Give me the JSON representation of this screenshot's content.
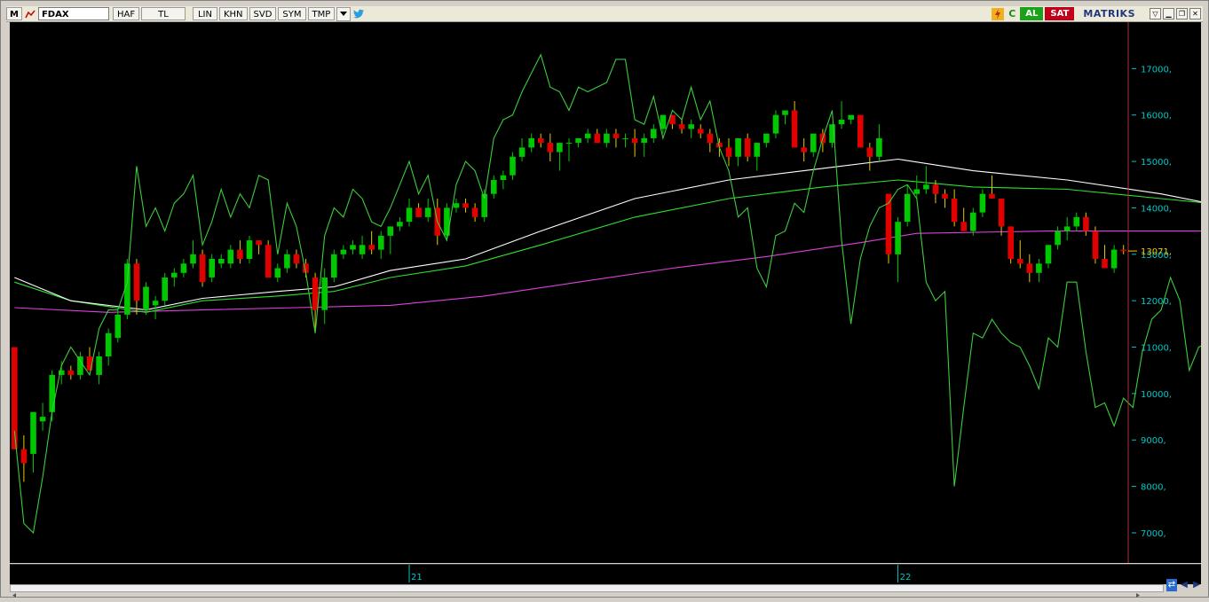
{
  "toolbar": {
    "m_label": "M",
    "symbol": "FDAX",
    "buttons": [
      "HAF",
      "TL",
      "LIN",
      "KHN",
      "SVD",
      "SYM",
      "TMP"
    ],
    "buy_label": "AL",
    "sell_label": "SAT",
    "brand": "MATRIKS"
  },
  "colors": {
    "background": "#000000",
    "up": "#00c800",
    "down": "#e00000",
    "ma_white": "#ffffff",
    "ma_green": "#2ee02e",
    "ma_magenta": "#e040e0",
    "indicator": "#3ccc3c",
    "axis_text": "#00c8c8",
    "last_price": "#e8c800"
  },
  "chart_data": {
    "type": "candlestick",
    "symbol": "FDAX",
    "last_price_label": "13071,",
    "y_ticks": [
      "7000,",
      "8000,",
      "9000,",
      "10000,",
      "11000,",
      "12000,",
      "13000,",
      "14000,",
      "15000,",
      "16000,",
      "17000,"
    ],
    "y_tick_values": [
      7000,
      8000,
      9000,
      10000,
      11000,
      12000,
      13000,
      14000,
      15000,
      16000,
      17000
    ],
    "ylim": [
      6350,
      18000
    ],
    "x_ticks": [
      "21",
      "22"
    ],
    "x_tick_index": [
      42,
      94
    ],
    "candles": [
      [
        11000,
        11000,
        8800,
        8800
      ],
      [
        8800,
        9100,
        8100,
        8500
      ],
      [
        8700,
        9600,
        8300,
        9600
      ],
      [
        9400,
        9800,
        9200,
        9500
      ],
      [
        9600,
        10500,
        9400,
        10400
      ],
      [
        10400,
        10700,
        10200,
        10500
      ],
      [
        10500,
        10600,
        10300,
        10400
      ],
      [
        10400,
        10900,
        10300,
        10800
      ],
      [
        10800,
        11000,
        10500,
        10500
      ],
      [
        10400,
        10900,
        10200,
        10800
      ],
      [
        10800,
        11400,
        10600,
        11300
      ],
      [
        11200,
        11800,
        11100,
        11700
      ],
      [
        11700,
        12900,
        11600,
        12800
      ],
      [
        12800,
        12900,
        11700,
        12000
      ],
      [
        11800,
        12400,
        11700,
        12300
      ],
      [
        11900,
        12100,
        11600,
        12000
      ],
      [
        12000,
        12600,
        11900,
        12500
      ],
      [
        12500,
        12700,
        12300,
        12600
      ],
      [
        12600,
        12900,
        12500,
        12800
      ],
      [
        12800,
        13300,
        12700,
        13000
      ],
      [
        13000,
        13100,
        12300,
        12400
      ],
      [
        12500,
        13000,
        12400,
        12900
      ],
      [
        12800,
        13000,
        12700,
        12900
      ],
      [
        12800,
        13200,
        12700,
        13100
      ],
      [
        13100,
        13300,
        12800,
        12900
      ],
      [
        12900,
        13400,
        12800,
        13300
      ],
      [
        13300,
        13300,
        13000,
        13200
      ],
      [
        13200,
        13300,
        12500,
        12500
      ],
      [
        12500,
        12800,
        12400,
        12700
      ],
      [
        12700,
        13100,
        12600,
        13000
      ],
      [
        13000,
        13100,
        12700,
        12800
      ],
      [
        12800,
        12900,
        12500,
        12600
      ],
      [
        12500,
        12600,
        11400,
        11800
      ],
      [
        11800,
        12700,
        11500,
        12500
      ],
      [
        12500,
        13100,
        12400,
        13000
      ],
      [
        13000,
        13200,
        12900,
        13100
      ],
      [
        13100,
        13300,
        13000,
        13200
      ],
      [
        13000,
        13400,
        12900,
        13200
      ],
      [
        13200,
        13500,
        13000,
        13100
      ],
      [
        13100,
        13500,
        12900,
        13400
      ],
      [
        13400,
        13600,
        13000,
        13600
      ],
      [
        13600,
        13800,
        13500,
        13700
      ],
      [
        13700,
        14200,
        13600,
        14000
      ],
      [
        14000,
        14100,
        13800,
        13800
      ],
      [
        13800,
        14200,
        13700,
        14000
      ],
      [
        14000,
        14200,
        13200,
        13400
      ],
      [
        13400,
        14100,
        13300,
        14000
      ],
      [
        14000,
        14200,
        13900,
        14100
      ],
      [
        14100,
        14200,
        13900,
        14000
      ],
      [
        14000,
        14100,
        13700,
        13800
      ],
      [
        13800,
        14400,
        13700,
        14300
      ],
      [
        14300,
        14700,
        14200,
        14600
      ],
      [
        14600,
        14800,
        14400,
        14700
      ],
      [
        14700,
        15200,
        14600,
        15100
      ],
      [
        15100,
        15500,
        15000,
        15300
      ],
      [
        15300,
        15600,
        15200,
        15500
      ],
      [
        15500,
        15600,
        15300,
        15400
      ],
      [
        15400,
        15600,
        15000,
        15200
      ],
      [
        15200,
        15400,
        14800,
        15400
      ],
      [
        15400,
        15500,
        15000,
        15400
      ],
      [
        15400,
        15500,
        15300,
        15500
      ],
      [
        15500,
        15700,
        15400,
        15600
      ],
      [
        15600,
        15700,
        15400,
        15400
      ],
      [
        15400,
        15700,
        15300,
        15600
      ],
      [
        15600,
        15700,
        15300,
        15500
      ],
      [
        15500,
        15600,
        15300,
        15500
      ],
      [
        15500,
        15700,
        15100,
        15400
      ],
      [
        15400,
        15600,
        15100,
        15500
      ],
      [
        15500,
        15800,
        15400,
        15700
      ],
      [
        15700,
        16000,
        15600,
        16000
      ],
      [
        16000,
        16000,
        15700,
        15800
      ],
      [
        15800,
        15900,
        15600,
        15700
      ],
      [
        15700,
        15900,
        15500,
        15800
      ],
      [
        15700,
        15800,
        15500,
        15600
      ],
      [
        15600,
        15700,
        15200,
        15400
      ],
      [
        15400,
        15500,
        15100,
        15300
      ],
      [
        15300,
        15500,
        14900,
        15100
      ],
      [
        15100,
        15500,
        14900,
        15500
      ],
      [
        15500,
        15600,
        15000,
        15100
      ],
      [
        15100,
        15400,
        14800,
        15400
      ],
      [
        15400,
        15600,
        15300,
        15600
      ],
      [
        15600,
        16100,
        15500,
        16000
      ],
      [
        16000,
        16100,
        15800,
        16100
      ],
      [
        16100,
        16300,
        15300,
        15300
      ],
      [
        15300,
        15500,
        15000,
        15200
      ],
      [
        15200,
        15600,
        15100,
        15600
      ],
      [
        15600,
        15700,
        15200,
        15400
      ],
      [
        15400,
        15800,
        15300,
        15800
      ],
      [
        15800,
        16300,
        15700,
        15900
      ],
      [
        15900,
        16000,
        15800,
        16000
      ],
      [
        16000,
        16000,
        15400,
        15300
      ],
      [
        15300,
        15400,
        14800,
        15100
      ],
      [
        15100,
        15800,
        15000,
        15500
      ],
      [
        14300,
        14300,
        12800,
        13000
      ],
      [
        13000,
        13800,
        12400,
        13700
      ],
      [
        13700,
        14500,
        13600,
        14300
      ],
      [
        14300,
        14700,
        14200,
        14400
      ],
      [
        14400,
        14900,
        14300,
        14500
      ],
      [
        14500,
        14600,
        14100,
        14300
      ],
      [
        14300,
        14400,
        14000,
        14200
      ],
      [
        14200,
        14400,
        13600,
        13700
      ],
      [
        13700,
        14000,
        13500,
        13500
      ],
      [
        13500,
        14000,
        13400,
        13900
      ],
      [
        13900,
        14400,
        13800,
        14300
      ],
      [
        14300,
        14700,
        14200,
        14200
      ],
      [
        14200,
        14200,
        13400,
        13600
      ],
      [
        13600,
        13600,
        12800,
        12900
      ],
      [
        12900,
        13300,
        12700,
        12800
      ],
      [
        12800,
        13000,
        12400,
        12600
      ],
      [
        12600,
        12900,
        12400,
        12800
      ],
      [
        12800,
        13200,
        12700,
        13200
      ],
      [
        13200,
        13600,
        13100,
        13500
      ],
      [
        13500,
        13800,
        13300,
        13600
      ],
      [
        13600,
        13900,
        13500,
        13800
      ],
      [
        13800,
        13900,
        13400,
        13500
      ],
      [
        13500,
        13600,
        12800,
        12900
      ],
      [
        12900,
        13200,
        12700,
        12700
      ],
      [
        12700,
        13200,
        12600,
        13100
      ],
      [
        13100,
        13200,
        13000,
        13071
      ]
    ],
    "ma_white": [
      [
        0,
        12500
      ],
      [
        6,
        12000
      ],
      [
        14,
        11800
      ],
      [
        20,
        12050
      ],
      [
        28,
        12200
      ],
      [
        34,
        12300
      ],
      [
        40,
        12650
      ],
      [
        48,
        12900
      ],
      [
        56,
        13500
      ],
      [
        66,
        14200
      ],
      [
        76,
        14600
      ],
      [
        86,
        14850
      ],
      [
        94,
        15050
      ],
      [
        102,
        14800
      ],
      [
        112,
        14600
      ],
      [
        122,
        14300
      ],
      [
        127,
        14100
      ]
    ],
    "ma_green": [
      [
        0,
        12400
      ],
      [
        6,
        12000
      ],
      [
        14,
        11750
      ],
      [
        20,
        12000
      ],
      [
        28,
        12100
      ],
      [
        34,
        12200
      ],
      [
        40,
        12500
      ],
      [
        48,
        12750
      ],
      [
        56,
        13200
      ],
      [
        66,
        13800
      ],
      [
        76,
        14200
      ],
      [
        86,
        14450
      ],
      [
        94,
        14600
      ],
      [
        102,
        14450
      ],
      [
        112,
        14400
      ],
      [
        122,
        14200
      ],
      [
        127,
        14100
      ]
    ],
    "ma_magenta": [
      [
        0,
        11850
      ],
      [
        10,
        11750
      ],
      [
        20,
        11800
      ],
      [
        30,
        11850
      ],
      [
        40,
        11900
      ],
      [
        50,
        12100
      ],
      [
        60,
        12400
      ],
      [
        70,
        12700
      ],
      [
        80,
        12950
      ],
      [
        90,
        13250
      ],
      [
        96,
        13450
      ],
      [
        110,
        13500
      ],
      [
        127,
        13500
      ]
    ],
    "indicator": [
      [
        0,
        9200
      ],
      [
        1,
        7200
      ],
      [
        2,
        7000
      ],
      [
        3,
        8200
      ],
      [
        4,
        9600
      ],
      [
        5,
        10600
      ],
      [
        6,
        11000
      ],
      [
        7,
        10700
      ],
      [
        8,
        10400
      ],
      [
        9,
        11400
      ],
      [
        10,
        11800
      ],
      [
        11,
        11800
      ],
      [
        12,
        12400
      ],
      [
        13,
        14900
      ],
      [
        14,
        13600
      ],
      [
        15,
        14000
      ],
      [
        16,
        13500
      ],
      [
        17,
        14100
      ],
      [
        18,
        14300
      ],
      [
        19,
        14700
      ],
      [
        20,
        13200
      ],
      [
        21,
        13700
      ],
      [
        22,
        14400
      ],
      [
        23,
        13800
      ],
      [
        24,
        14300
      ],
      [
        25,
        14000
      ],
      [
        26,
        14700
      ],
      [
        27,
        14600
      ],
      [
        28,
        13000
      ],
      [
        29,
        14100
      ],
      [
        30,
        13600
      ],
      [
        31,
        12600
      ],
      [
        32,
        11300
      ],
      [
        33,
        13400
      ],
      [
        34,
        14000
      ],
      [
        35,
        13800
      ],
      [
        36,
        14400
      ],
      [
        37,
        14200
      ],
      [
        38,
        13700
      ],
      [
        39,
        13600
      ],
      [
        40,
        14000
      ],
      [
        41,
        14500
      ],
      [
        42,
        15000
      ],
      [
        43,
        14300
      ],
      [
        44,
        14700
      ],
      [
        45,
        13700
      ],
      [
        46,
        13300
      ],
      [
        47,
        14500
      ],
      [
        48,
        15000
      ],
      [
        49,
        14800
      ],
      [
        50,
        14200
      ],
      [
        51,
        15500
      ],
      [
        52,
        15900
      ],
      [
        53,
        16000
      ],
      [
        54,
        16500
      ],
      [
        55,
        16900
      ],
      [
        56,
        17300
      ],
      [
        57,
        16600
      ],
      [
        58,
        16500
      ],
      [
        59,
        16100
      ],
      [
        60,
        16600
      ],
      [
        61,
        16500
      ],
      [
        62,
        16600
      ],
      [
        63,
        16700
      ],
      [
        64,
        17200
      ],
      [
        65,
        17200
      ],
      [
        66,
        15900
      ],
      [
        67,
        15800
      ],
      [
        68,
        16400
      ],
      [
        69,
        15500
      ],
      [
        70,
        16100
      ],
      [
        71,
        15900
      ],
      [
        72,
        16600
      ],
      [
        73,
        15900
      ],
      [
        74,
        16300
      ],
      [
        75,
        15300
      ],
      [
        76,
        14800
      ],
      [
        77,
        13800
      ],
      [
        78,
        14000
      ],
      [
        79,
        12700
      ],
      [
        80,
        12300
      ],
      [
        81,
        13400
      ],
      [
        82,
        13500
      ],
      [
        83,
        14100
      ],
      [
        84,
        13900
      ],
      [
        85,
        14800
      ],
      [
        86,
        15500
      ],
      [
        87,
        16100
      ],
      [
        88,
        13300
      ],
      [
        89,
        11500
      ],
      [
        90,
        12900
      ],
      [
        91,
        13600
      ],
      [
        92,
        14000
      ],
      [
        93,
        14100
      ],
      [
        94,
        14400
      ],
      [
        95,
        14500
      ],
      [
        96,
        14200
      ],
      [
        97,
        12400
      ],
      [
        98,
        12000
      ],
      [
        99,
        12200
      ],
      [
        100,
        8000
      ],
      [
        101,
        9700
      ],
      [
        102,
        11300
      ],
      [
        103,
        11200
      ],
      [
        104,
        11600
      ],
      [
        105,
        11300
      ],
      [
        106,
        11100
      ],
      [
        107,
        11000
      ],
      [
        108,
        10600
      ],
      [
        109,
        10100
      ],
      [
        110,
        11200
      ],
      [
        111,
        11000
      ],
      [
        112,
        12400
      ],
      [
        113,
        12400
      ],
      [
        114,
        10900
      ],
      [
        115,
        9700
      ],
      [
        116,
        9800
      ],
      [
        117,
        9300
      ],
      [
        118,
        9900
      ],
      [
        119,
        9700
      ],
      [
        120,
        10900
      ],
      [
        121,
        11600
      ],
      [
        122,
        11800
      ],
      [
        123,
        12500
      ],
      [
        124,
        12000
      ],
      [
        125,
        10500
      ],
      [
        126,
        11000
      ],
      [
        127,
        11100
      ]
    ]
  }
}
